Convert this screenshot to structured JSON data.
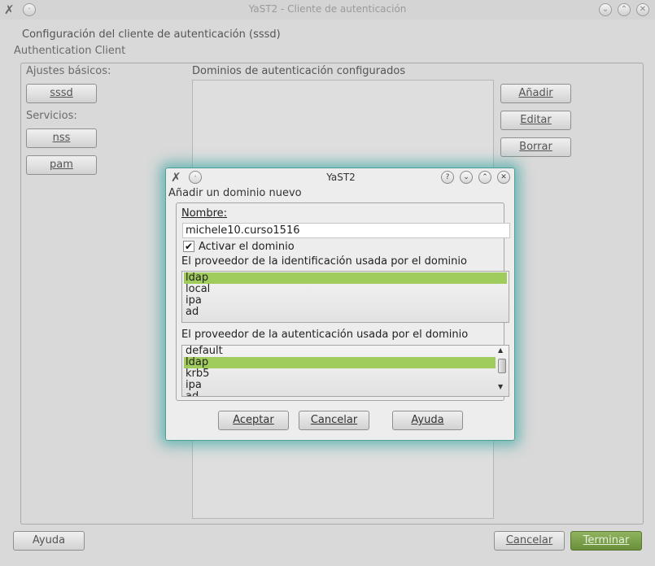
{
  "window": {
    "title": "YaST2 - Cliente de autenticación",
    "heading": "Configuración del cliente de autenticación (sssd)",
    "subheading": "Authentication Client"
  },
  "left": {
    "basic_label": "Ajustes básicos:",
    "sssd_button": "sssd",
    "services_label": "Servicios:",
    "nss_button": "nss",
    "pam_button": "pam"
  },
  "domains": {
    "label": "Dominios de autenticación configurados",
    "add_button": "Añadir",
    "edit_button": "Editar",
    "delete_button": "Borrar"
  },
  "footer": {
    "help_button": "Ayuda",
    "cancel_button": "Cancelar",
    "finish_button": "Terminar"
  },
  "dialog": {
    "title": "YaST2",
    "heading": "Añadir un dominio nuevo",
    "name_label": "Nombre:",
    "name_value": "michele10.curso1516",
    "activate_label": "Activar el dominio",
    "activate_checked": true,
    "id_provider_label": "El proveedor de la identificación usada por el dominio",
    "id_providers": [
      "ldap",
      "local",
      "ipa",
      "ad"
    ],
    "id_provider_selected": "ldap",
    "auth_provider_label": "El proveedor de la autenticación usada por el dominio",
    "auth_providers": [
      "default",
      "ldap",
      "krb5",
      "ipa",
      "ad"
    ],
    "auth_provider_selected": "ldap",
    "accept_button": "Aceptar",
    "cancel_button": "Cancelar",
    "help_button": "Ayuda"
  }
}
